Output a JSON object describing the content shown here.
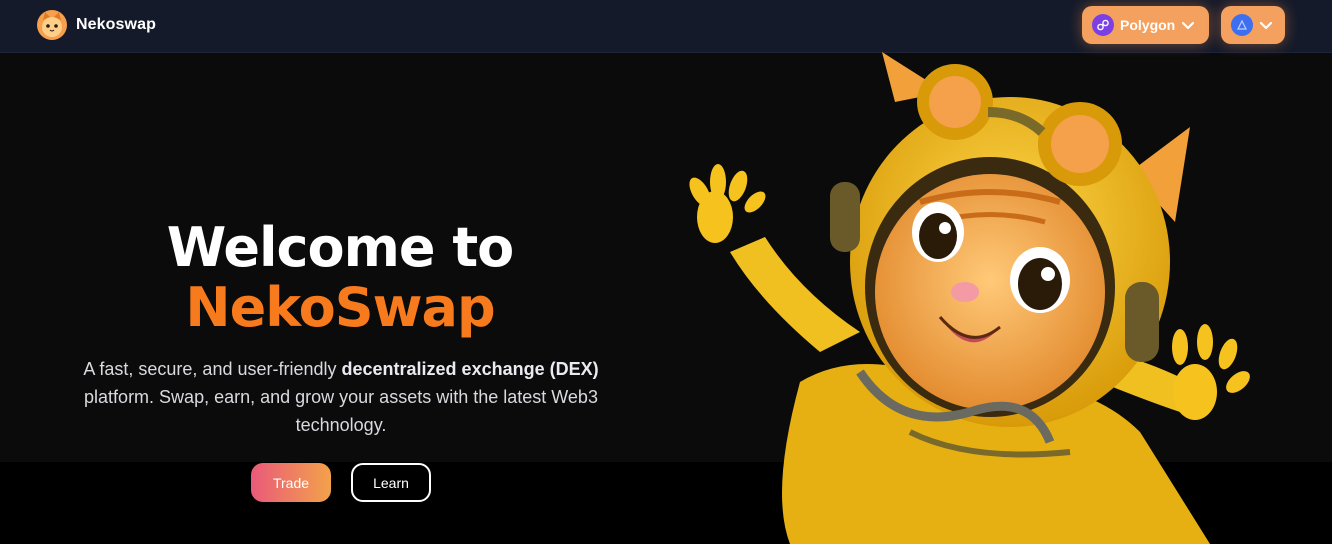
{
  "brand": {
    "name": "Nekoswap",
    "logo_icon": "cat-face-icon"
  },
  "header": {
    "network_selector": {
      "label": "Polygon",
      "icon": "polygon-chain-icon"
    },
    "wallet_selector": {
      "icon": "wallet-network-icon"
    }
  },
  "hero": {
    "title_line1": "Welcome to",
    "title_line2": "NekoSwap",
    "description_before": "A fast, secure, and user-friendly ",
    "description_bold": "decentralized exchange (DEX)",
    "description_after": " platform. Swap, earn, and grow your assets with the latest Web3 technology.",
    "trade_label": "Trade",
    "learn_label": "Learn"
  },
  "colors": {
    "accent_orange": "#f77a1d",
    "pill_bg": "#f4a05e",
    "nav_bg": "#141a2a",
    "page_bg": "#0b0b0c"
  }
}
